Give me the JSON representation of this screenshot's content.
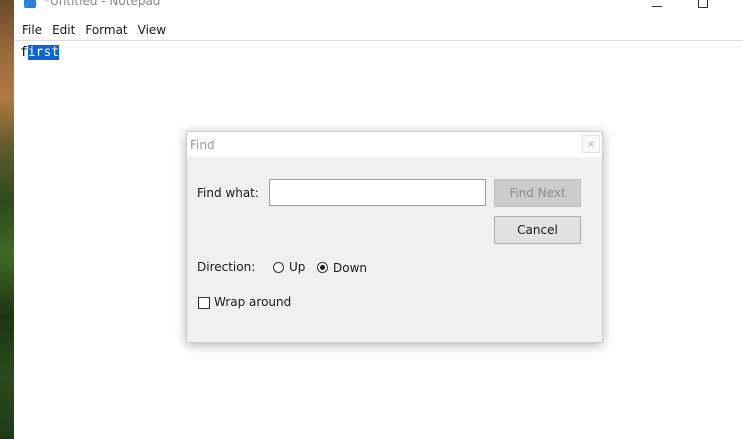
{
  "window": {
    "title": "*Untitled - Notepad"
  },
  "menubar": {
    "items": [
      {
        "label": "File"
      },
      {
        "label": "Edit"
      },
      {
        "label": "Format"
      },
      {
        "label": "View"
      }
    ]
  },
  "editor": {
    "text_unselected": "f",
    "text_selected": "irst"
  },
  "find_dialog": {
    "title": "Find",
    "close_glyph": "×",
    "find_what_label": "Find what:",
    "find_what_value": "",
    "find_next_label": "Find Next",
    "cancel_label": "Cancel",
    "direction_label": "Direction:",
    "direction_up_label": "Up",
    "direction_down_label": "Down",
    "direction_selected": "Down",
    "wrap_around_label": "Wrap around",
    "wrap_around_checked": false
  },
  "colors": {
    "selection": "#0a64d2",
    "dialog_bg": "#f0f0f0"
  }
}
